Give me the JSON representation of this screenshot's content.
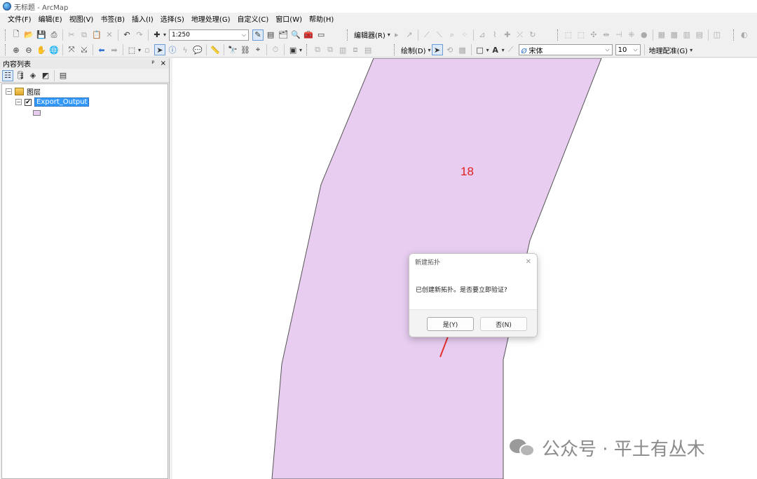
{
  "window": {
    "title": "无标题 - ArcMap"
  },
  "menu": [
    "文件(F)",
    "编辑(E)",
    "视图(V)",
    "书签(B)",
    "插入(I)",
    "选择(S)",
    "地理处理(G)",
    "自定义(C)",
    "窗口(W)",
    "帮助(H)"
  ],
  "toolbar": {
    "scale": "1:250",
    "editor_label": "编辑器(R)",
    "draw_label": "绘制(D)",
    "font_name": "宋体",
    "font_size": "10",
    "georef_label": "地理配准(G)"
  },
  "toc": {
    "title": "内容列表",
    "pin": "ᵖ",
    "close": "×",
    "root_label": "图层",
    "layer_name": "Export_Output",
    "layer_checked": "✔",
    "swatch_color": "#e8cdf0"
  },
  "map": {
    "label": "18",
    "polygon_fill": "#e8cdf0",
    "polygon_stroke": "#555555"
  },
  "dialog": {
    "title": "新建拓扑",
    "message": "已创建新拓扑。是否要立即验证?",
    "yes_label": "是(Y)",
    "no_label": "否(N)",
    "close": "✕"
  },
  "watermark": {
    "text": "公众号 · 平土有丛木"
  }
}
